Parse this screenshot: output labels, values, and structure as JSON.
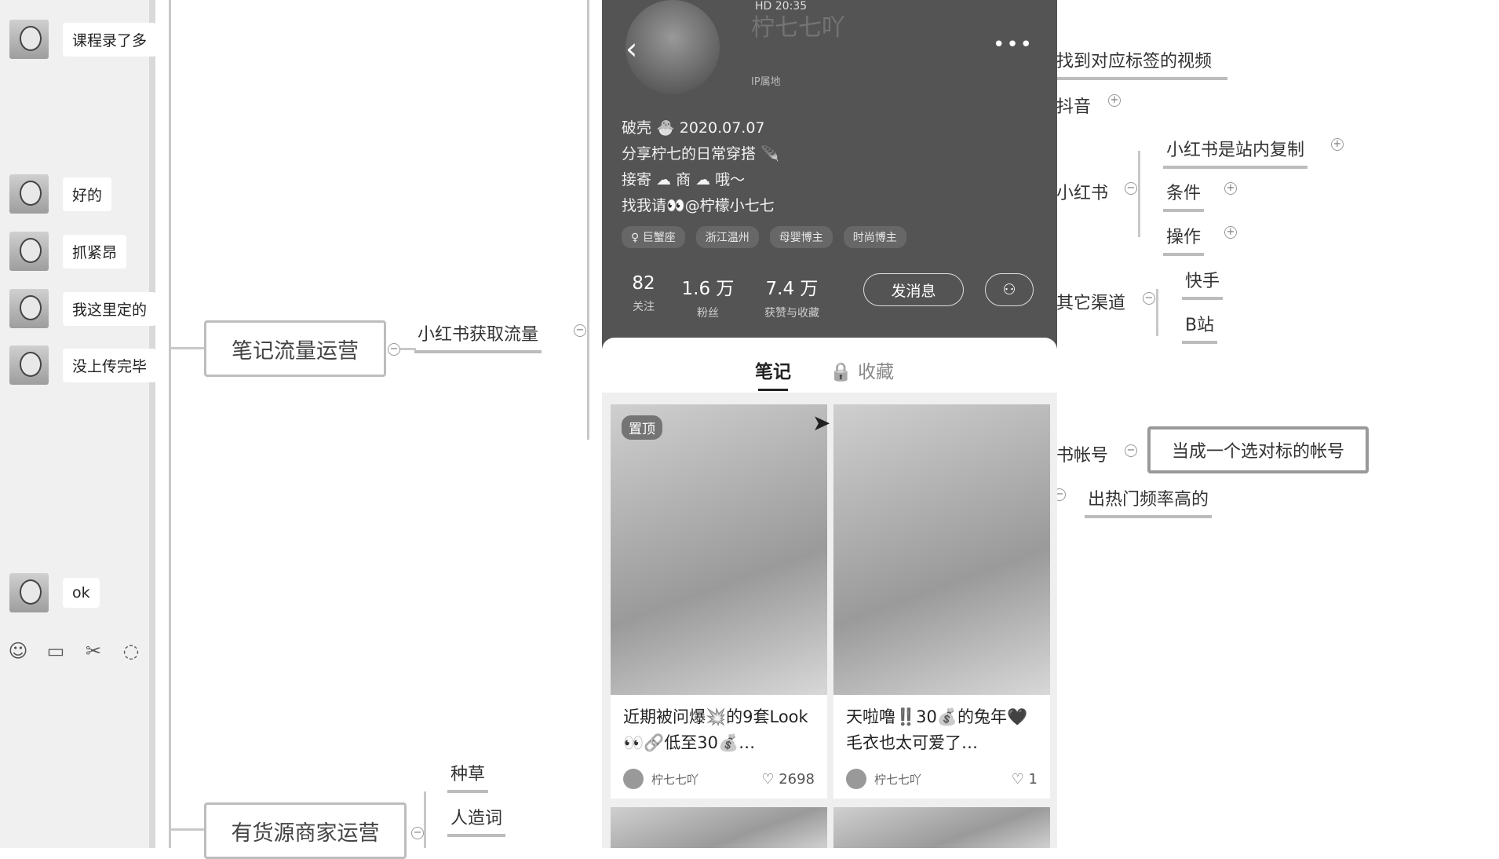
{
  "chat": {
    "messages": [
      {
        "text": "课程录了多"
      },
      {
        "text": "好的"
      },
      {
        "text": "抓紧昂"
      },
      {
        "text": "我这里定的"
      },
      {
        "text": "没上传完毕"
      },
      {
        "text": "ok"
      }
    ],
    "toolbar": [
      "emoji-icon",
      "folder-icon",
      "scissors-icon",
      "chat-icon"
    ]
  },
  "mindmap": {
    "note_traffic": "笔记流量运营",
    "xhs_traffic": "小红书获取流量",
    "merchant": "有货源商家运营",
    "zhongcao": "种草",
    "zaoci": "人造词",
    "find_video": "找到对应标签的视频",
    "douyin": "抖音",
    "xiaohongshu": "小红书",
    "copy_inside": "小红书是站内复制",
    "condition": "条件",
    "operation": "操作",
    "other_channels": "其它渠道",
    "kuaishou": "快手",
    "bilibili": "B站",
    "account": "书帐号",
    "benchmark": "当成一个选对标的帐号",
    "hot_freq": "出热门频率高的"
  },
  "phone": {
    "status_text": "HD 20:35",
    "name_faded": "柠七七吖",
    "ip": "IP属地",
    "bio": [
      "破壳 🐣 2020.07.07",
      "分享柠七的日常穿搭 🪶",
      "接寄 ☁ 商 ☁ 哦～",
      "找我请👀@柠檬小七七"
    ],
    "tags": [
      "♀ 巨蟹座",
      "浙江温州",
      "母婴博主",
      "时尚博主"
    ],
    "stats": [
      {
        "n": "82",
        "l": "关注"
      },
      {
        "n": "1.6 万",
        "l": "粉丝"
      },
      {
        "n": "7.4 万",
        "l": "获赞与收藏"
      }
    ],
    "send_message": "发消息",
    "tab_notes": "笔记",
    "tab_fav": "收藏",
    "pin": "置顶",
    "cards": [
      {
        "title": "近期被问爆💥的9套Look👀🔗低至30💰…",
        "author": "柠七七吖",
        "likes": "2698"
      },
      {
        "title": "天啦噜‼️30💰的兔年🖤毛衣也太可爱了…",
        "author": "柠七七吖",
        "likes": "1"
      }
    ]
  }
}
